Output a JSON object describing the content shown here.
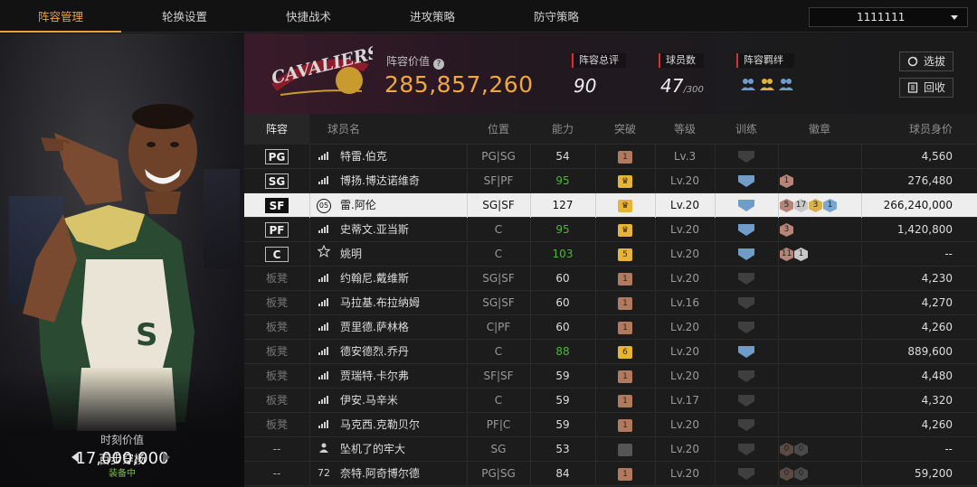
{
  "nav": {
    "tabs": [
      {
        "label": "阵容管理",
        "active": true
      },
      {
        "label": "轮换设置",
        "active": false
      },
      {
        "label": "快捷战术",
        "active": false
      },
      {
        "label": "进攻策略",
        "active": false
      },
      {
        "label": "防守策略",
        "active": false
      }
    ],
    "team_selector": "1111111"
  },
  "left_panel": {
    "moment_label": "时刻价值",
    "moment_value": "17,000,000",
    "skin_name": "百步穿杨",
    "equip_status": "装备中"
  },
  "team": {
    "logo_icon": "cavaliers-logo",
    "value_label": "阵容价值",
    "value": "285,857,260",
    "stats": [
      {
        "label": "阵容总评",
        "value": "90"
      },
      {
        "label": "球员数",
        "value": "47",
        "suffix": "/300"
      },
      {
        "label": "阵容羁绊"
      }
    ],
    "bond_icons": [
      "team-bond-icon-blue",
      "team-bond-icon-gold",
      "team-bond-icon-blue"
    ],
    "buttons": {
      "select": "选拔",
      "recycle": "回收"
    }
  },
  "table": {
    "headers": [
      "阵容",
      "球员名",
      "位置",
      "能力",
      "突破",
      "等级",
      "训练",
      "徽章",
      "球员身价"
    ],
    "rows": [
      {
        "slot": "PG",
        "icon": "signal-icon",
        "name": "特雷.伯克",
        "position": "PG|SG",
        "ability": "54",
        "breakthrough": {
          "v": "1",
          "t": "bronze"
        },
        "level": "Lv.3",
        "training": "gray",
        "badges": [],
        "value": "4,560"
      },
      {
        "slot": "SG",
        "icon": "signal-icon",
        "name": "博扬.博达诺维奇",
        "position": "SF|PF",
        "ability": "95",
        "ability_color": "green",
        "breakthrough": {
          "v": "♛",
          "t": "gold"
        },
        "level": "Lv.20",
        "training": "blue",
        "badges": [
          {
            "v": "1",
            "c": "#b5857a"
          }
        ],
        "value": "276,480"
      },
      {
        "slot": "SF",
        "icon": "jersey-05-icon",
        "icon_text": "05",
        "name": "雷.阿伦",
        "position": "SG|SF",
        "ability": "127",
        "breakthrough": {
          "v": "♛",
          "t": "gold"
        },
        "level": "Lv.20",
        "training": "blue",
        "badges": [
          {
            "v": "5",
            "c": "#b5857a"
          },
          {
            "v": "17",
            "c": "#c8c8c8"
          },
          {
            "v": "3",
            "c": "#d8b14a"
          },
          {
            "v": "1",
            "c": "#7aa6d0"
          }
        ],
        "value": "266,240,000",
        "selected": true
      },
      {
        "slot": "PF",
        "icon": "signal-icon",
        "name": "史蒂文.亚当斯",
        "position": "C",
        "ability": "95",
        "ability_color": "green",
        "breakthrough": {
          "v": "♛",
          "t": "gold"
        },
        "level": "Lv.20",
        "training": "blue",
        "badges": [
          {
            "v": "3",
            "c": "#b5857a"
          }
        ],
        "value": "1,420,800"
      },
      {
        "slot": "C",
        "icon": "star-icon",
        "name": "姚明",
        "position": "C",
        "ability": "103",
        "ability_color": "green",
        "breakthrough": {
          "v": "5",
          "t": "gold"
        },
        "level": "Lv.20",
        "training": "blue",
        "badges": [
          {
            "v": "11",
            "c": "#b5857a"
          },
          {
            "v": "1",
            "c": "#c8c8c8"
          }
        ],
        "value": "--"
      },
      {
        "slot": "板凳",
        "icon": "signal-icon",
        "name": "约翰尼.戴维斯",
        "position": "SG|SF",
        "ability": "60",
        "breakthrough": {
          "v": "1",
          "t": "bronze"
        },
        "level": "Lv.20",
        "training": "gray",
        "badges": [],
        "value": "4,230"
      },
      {
        "slot": "板凳",
        "icon": "signal-icon",
        "name": "马拉基.布拉纳姆",
        "position": "SG|SF",
        "ability": "60",
        "breakthrough": {
          "v": "1",
          "t": "bronze"
        },
        "level": "Lv.16",
        "training": "gray",
        "badges": [],
        "value": "4,270"
      },
      {
        "slot": "板凳",
        "icon": "signal-icon",
        "name": "贾里德.萨林格",
        "position": "C|PF",
        "ability": "60",
        "breakthrough": {
          "v": "1",
          "t": "bronze"
        },
        "level": "Lv.20",
        "training": "gray",
        "badges": [],
        "value": "4,260"
      },
      {
        "slot": "板凳",
        "icon": "signal-icon",
        "name": "德安德烈.乔丹",
        "position": "C",
        "ability": "88",
        "ability_color": "green",
        "breakthrough": {
          "v": "6",
          "t": "gold"
        },
        "level": "Lv.20",
        "training": "blue",
        "badges": [],
        "value": "889,600"
      },
      {
        "slot": "板凳",
        "icon": "signal-icon",
        "name": "贾瑞特.卡尔弗",
        "position": "SF|SF",
        "ability": "59",
        "breakthrough": {
          "v": "1",
          "t": "bronze"
        },
        "level": "Lv.20",
        "training": "gray",
        "badges": [],
        "value": "4,480"
      },
      {
        "slot": "板凳",
        "icon": "signal-icon",
        "name": "伊安.马辛米",
        "position": "C",
        "ability": "59",
        "breakthrough": {
          "v": "1",
          "t": "bronze"
        },
        "level": "Lv.17",
        "training": "gray",
        "badges": [],
        "value": "4,320"
      },
      {
        "slot": "板凳",
        "icon": "signal-icon",
        "name": "马克西.克勒贝尔",
        "position": "PF|C",
        "ability": "59",
        "breakthrough": {
          "v": "1",
          "t": "bronze"
        },
        "level": "Lv.20",
        "training": "gray",
        "badges": [],
        "value": "4,260"
      },
      {
        "slot": "--",
        "icon": "user-icon",
        "name": "坠机了的牢大",
        "position": "SG",
        "ability": "53",
        "breakthrough": {
          "v": "",
          "t": "dark"
        },
        "level": "Lv.20",
        "training": "gray",
        "badges": [
          {
            "v": "0",
            "c": "#5a4a44"
          },
          {
            "v": "0",
            "c": "#4a4a4a"
          }
        ],
        "value": "--"
      },
      {
        "slot": "--",
        "icon": "jersey-72-icon",
        "icon_text": "72",
        "name": "奈特.阿奇博尔德",
        "position": "PG|SG",
        "ability": "84",
        "breakthrough": {
          "v": "1",
          "t": "bronze"
        },
        "level": "Lv.20",
        "training": "gray",
        "badges": [
          {
            "v": "0",
            "c": "#5a4a44"
          },
          {
            "v": "0",
            "c": "#4a4a4a"
          }
        ],
        "value": "59,200"
      }
    ]
  }
}
